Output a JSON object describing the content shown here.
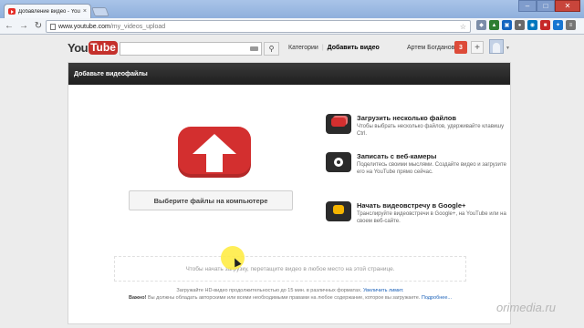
{
  "browser": {
    "tab_title": "Добавление видео - YouTu",
    "url_host": "www.youtube.com",
    "url_path": "/my_videos_upload",
    "window_controls": [
      "–",
      "□",
      "✕"
    ]
  },
  "header": {
    "logo_you": "You",
    "logo_tube": "Tube",
    "search_placeholder": "",
    "nav": {
      "categories": "Категории",
      "add_video": "Добавить видео"
    },
    "user_name": "Артем Богданов",
    "notifications": "3",
    "plus": "+"
  },
  "main": {
    "panel_title": "Добавьте видеофайлы",
    "select_files_button": "Выберите файлы на компьютере",
    "options": [
      {
        "title": "Загрузить несколько файлов",
        "desc": "Чтобы выбрать несколько файлов, удерживайте клавишу Ctrl.",
        "icon": "multi-upload-icon"
      },
      {
        "title": "Записать с веб-камеры",
        "desc": "Поделитесь своими мыслями. Создайте видео и загрузите его на YouTube прямо сейчас.",
        "icon": "webcam-icon"
      },
      {
        "title": "Начать видеовстречу в Google+",
        "desc": "Транслируйте видеовстречи в Google+, на YouTube или на своем веб-сайте.",
        "icon": "hangout-icon"
      }
    ],
    "dropzone_text": "Чтобы начать загрузку, перетащите видео в любое место на этой странице.",
    "footnote_1": "Загружайте HD-видео продолжительностью до 15 мин. в различных форматах.",
    "footnote_1_link": "Увеличить лимит.",
    "footnote_2_bold": "Важно!",
    "footnote_2": "Вы должны обладать авторскими или всеми необходимыми правами на любое содержание, которое вы загружаете.",
    "footnote_2_link": "Подробнее..."
  },
  "watermark": "orimedia.ru",
  "colors": {
    "youtube_red": "#d32f2f",
    "header_bar": "#1f1f1f",
    "link": "#1c62b9"
  }
}
